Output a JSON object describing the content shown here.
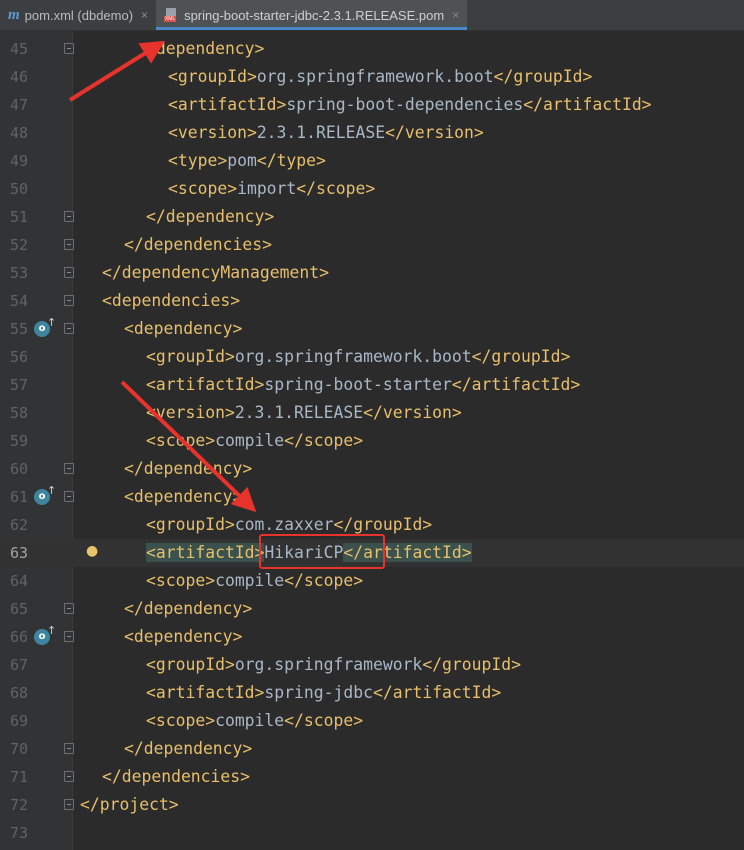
{
  "tabs": [
    {
      "icon": "maven-icon",
      "label": "pom.xml (dbdemo)",
      "active": false
    },
    {
      "icon": "xml-file-icon",
      "label": "spring-boot-starter-jdbc-2.3.1.RELEASE.pom",
      "active": true
    }
  ],
  "tab_icon_text": {
    "maven": "m",
    "xml": "XML"
  },
  "close_glyph": "×",
  "editor": {
    "current_line": 63,
    "lines": [
      {
        "n": "45",
        "indent": 6,
        "tokens": [
          {
            "t": "<dependency>",
            "k": "tag"
          }
        ],
        "fold": true
      },
      {
        "n": "46",
        "indent": 8,
        "tokens": [
          {
            "t": "<groupId>",
            "k": "tag"
          },
          {
            "t": "org.springframework.boot",
            "k": "txt"
          },
          {
            "t": "</groupId>",
            "k": "tag"
          }
        ]
      },
      {
        "n": "47",
        "indent": 8,
        "tokens": [
          {
            "t": "<artifactId>",
            "k": "tag"
          },
          {
            "t": "spring-boot-dependencies",
            "k": "txt"
          },
          {
            "t": "</artifactId>",
            "k": "tag"
          }
        ]
      },
      {
        "n": "48",
        "indent": 8,
        "tokens": [
          {
            "t": "<version>",
            "k": "tag"
          },
          {
            "t": "2.3.1.RELEASE",
            "k": "txt"
          },
          {
            "t": "</version>",
            "k": "tag"
          }
        ]
      },
      {
        "n": "49",
        "indent": 8,
        "tokens": [
          {
            "t": "<type>",
            "k": "tag"
          },
          {
            "t": "pom",
            "k": "txt"
          },
          {
            "t": "</type>",
            "k": "tag"
          }
        ]
      },
      {
        "n": "50",
        "indent": 8,
        "tokens": [
          {
            "t": "<scope>",
            "k": "tag"
          },
          {
            "t": "import",
            "k": "txt"
          },
          {
            "t": "</scope>",
            "k": "tag"
          }
        ]
      },
      {
        "n": "51",
        "indent": 6,
        "tokens": [
          {
            "t": "</dependency>",
            "k": "tag"
          }
        ],
        "fold": true
      },
      {
        "n": "52",
        "indent": 4,
        "tokens": [
          {
            "t": "</dependencies>",
            "k": "tag"
          }
        ],
        "fold": true
      },
      {
        "n": "53",
        "indent": 2,
        "tokens": [
          {
            "t": "</dependencyManagement>",
            "k": "tag"
          }
        ],
        "fold": true
      },
      {
        "n": "54",
        "indent": 2,
        "tokens": [
          {
            "t": "<dependencies>",
            "k": "tag"
          }
        ],
        "fold": true
      },
      {
        "n": "55",
        "indent": 4,
        "tokens": [
          {
            "t": "<dependency>",
            "k": "tag"
          }
        ],
        "fold": true,
        "override": true
      },
      {
        "n": "56",
        "indent": 6,
        "tokens": [
          {
            "t": "<groupId>",
            "k": "tag"
          },
          {
            "t": "org.springframework.boot",
            "k": "txt"
          },
          {
            "t": "</groupId>",
            "k": "tag"
          }
        ]
      },
      {
        "n": "57",
        "indent": 6,
        "tokens": [
          {
            "t": "<artifactId>",
            "k": "tag"
          },
          {
            "t": "spring-boot-starter",
            "k": "txt"
          },
          {
            "t": "</artifactId>",
            "k": "tag"
          }
        ]
      },
      {
        "n": "58",
        "indent": 6,
        "tokens": [
          {
            "t": "<version>",
            "k": "tag"
          },
          {
            "t": "2.3.1.RELEASE",
            "k": "txt"
          },
          {
            "t": "</version>",
            "k": "tag"
          }
        ]
      },
      {
        "n": "59",
        "indent": 6,
        "tokens": [
          {
            "t": "<scope>",
            "k": "tag"
          },
          {
            "t": "compile",
            "k": "txt"
          },
          {
            "t": "</scope>",
            "k": "tag"
          }
        ]
      },
      {
        "n": "60",
        "indent": 4,
        "tokens": [
          {
            "t": "</dependency>",
            "k": "tag"
          }
        ],
        "fold": true
      },
      {
        "n": "61",
        "indent": 4,
        "tokens": [
          {
            "t": "<dependency>",
            "k": "tag"
          }
        ],
        "fold": true,
        "override": true
      },
      {
        "n": "62",
        "indent": 6,
        "tokens": [
          {
            "t": "<groupId>",
            "k": "tag"
          },
          {
            "t": "com.zaxxer",
            "k": "txt"
          },
          {
            "t": "</groupId>",
            "k": "tag"
          }
        ]
      },
      {
        "n": "63",
        "indent": 6,
        "tokens": [
          {
            "t": "<artifactId>",
            "k": "tag",
            "hl": true
          },
          {
            "t": "HikariCP",
            "k": "txt"
          },
          {
            "t": "</artifactId>",
            "k": "tag",
            "hl": true
          }
        ],
        "bulb": true
      },
      {
        "n": "64",
        "indent": 6,
        "tokens": [
          {
            "t": "<scope>",
            "k": "tag"
          },
          {
            "t": "compile",
            "k": "txt"
          },
          {
            "t": "</scope>",
            "k": "tag"
          }
        ]
      },
      {
        "n": "65",
        "indent": 4,
        "tokens": [
          {
            "t": "</dependency>",
            "k": "tag"
          }
        ],
        "fold": true
      },
      {
        "n": "66",
        "indent": 4,
        "tokens": [
          {
            "t": "<dependency>",
            "k": "tag"
          }
        ],
        "fold": true,
        "override": true
      },
      {
        "n": "67",
        "indent": 6,
        "tokens": [
          {
            "t": "<groupId>",
            "k": "tag"
          },
          {
            "t": "org.springframework",
            "k": "txt"
          },
          {
            "t": "</groupId>",
            "k": "tag"
          }
        ]
      },
      {
        "n": "68",
        "indent": 6,
        "tokens": [
          {
            "t": "<artifactId>",
            "k": "tag"
          },
          {
            "t": "spring-jdbc",
            "k": "txt"
          },
          {
            "t": "</artifactId>",
            "k": "tag"
          }
        ]
      },
      {
        "n": "69",
        "indent": 6,
        "tokens": [
          {
            "t": "<scope>",
            "k": "tag"
          },
          {
            "t": "compile",
            "k": "txt"
          },
          {
            "t": "</scope>",
            "k": "tag"
          }
        ]
      },
      {
        "n": "70",
        "indent": 4,
        "tokens": [
          {
            "t": "</dependency>",
            "k": "tag"
          }
        ],
        "fold": true
      },
      {
        "n": "71",
        "indent": 2,
        "tokens": [
          {
            "t": "</dependencies>",
            "k": "tag"
          }
        ],
        "fold": true
      },
      {
        "n": "72",
        "indent": 0,
        "tokens": [
          {
            "t": "</project>",
            "k": "tag"
          }
        ],
        "fold": true
      },
      {
        "n": "73",
        "indent": 0,
        "tokens": []
      }
    ]
  },
  "colors": {
    "background": "#2b2b2b",
    "tag": "#e8bf6a",
    "text": "#a9b7c6",
    "annotation": "#e8322c"
  },
  "annotations": {
    "highlight_box_target": "HikariCP",
    "arrows": 2
  }
}
